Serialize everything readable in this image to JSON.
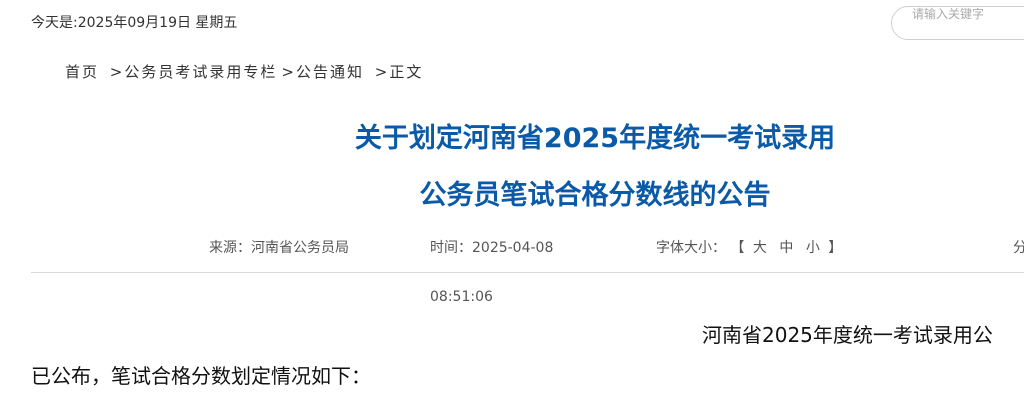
{
  "header": {
    "date_text": "今天是:2025年09月19日 星期五",
    "search_placeholder": "请输入关键字"
  },
  "breadcrumb": {
    "items": [
      "首页",
      "公务员考试录用专栏",
      "公告通知",
      "正文"
    ],
    "separator": ">"
  },
  "article": {
    "title_line1": "关于划定河南省2025年度统一考试录用",
    "title_line2": "公务员笔试合格分数线的公告",
    "title_color": "#0b5aa8",
    "source": "来源：河南省公务员局",
    "time_label": "时间：2025-04-08",
    "time_rest": "08:51:06",
    "fontsize_label": "字体大小：",
    "fontsize_open": "【",
    "fontsize_close": "】",
    "fontsize_options": [
      "大",
      "中",
      "小"
    ],
    "extra_meta_fragment": "分",
    "body_line1": "河南省2025年度统一考试录用公",
    "body_line2": "已公布，笔试合格分数划定情况如下："
  }
}
